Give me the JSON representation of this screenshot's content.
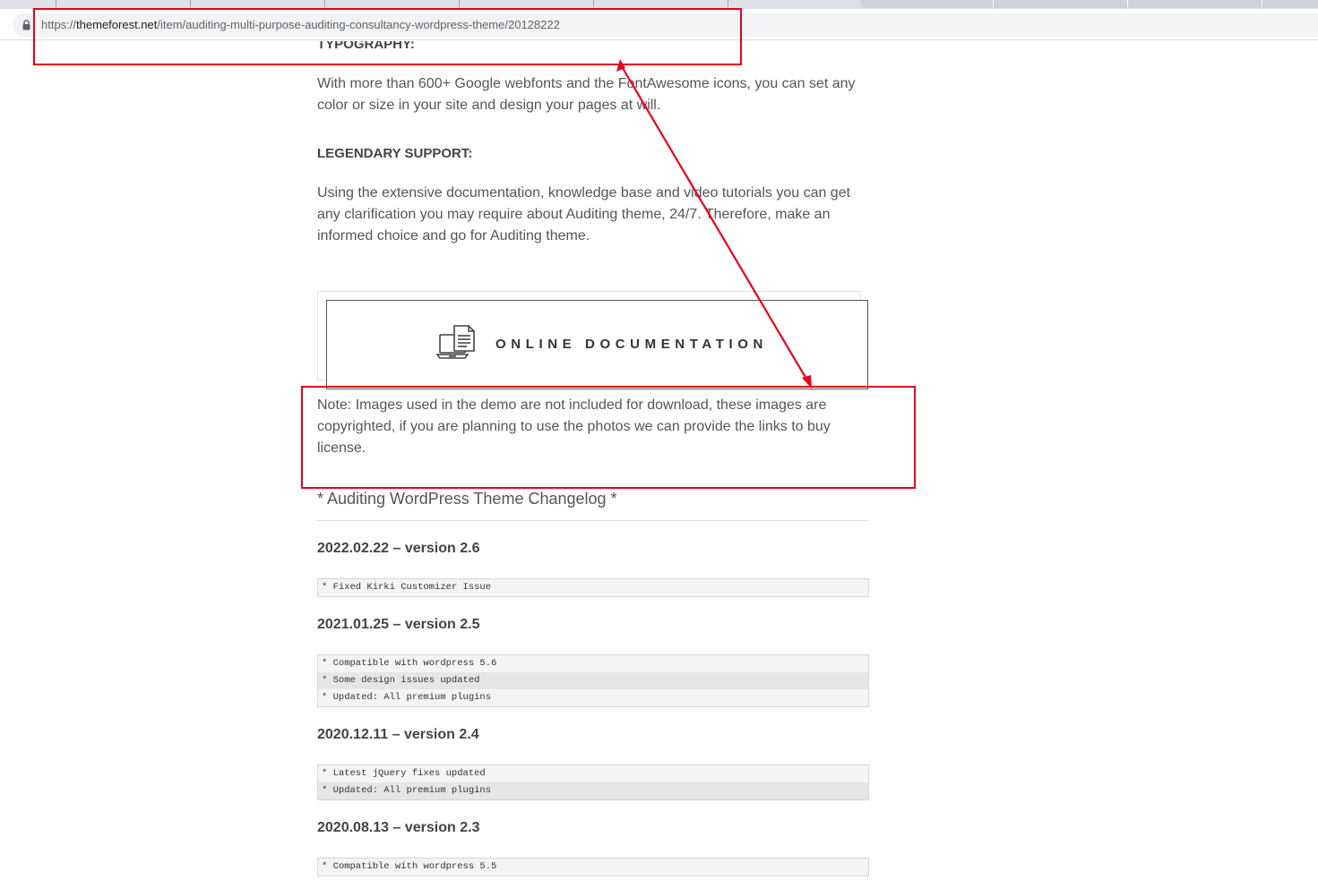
{
  "browser": {
    "url_prefix": "https://",
    "url_domain": "themeforest.net",
    "url_path": "/item/auditing-multi-purpose-auditing-consultancy-wordpress-theme/20128222"
  },
  "content": {
    "typography_heading": "TYPOGRAPHY:",
    "typography_text": "With more than 600+ Google webfonts and the FontAwesome icons, you can set any color or size in your site and design your pages at will.",
    "support_heading": "LEGENDARY SUPPORT:",
    "support_text": "Using the extensive documentation, knowledge base and video tutorials you can get any clarification you may require about Auditing theme, 24/7. Therefore, make an informed choice and go for Auditing theme.",
    "doc_button_label": "ONLINE DOCUMENTATION",
    "note_text": "Note: Images used in the demo are not included for download, these images are copyrighted, if you are planning to use the photos we can provide the links to buy license.",
    "changelog_title": "* Auditing WordPress Theme Changelog *"
  },
  "changelog": [
    {
      "version": "2022.02.22 – version 2.6",
      "lines": [
        "* Fixed Kirki Customizer Issue"
      ]
    },
    {
      "version": "2021.01.25 – version 2.5",
      "lines": [
        "* Compatible with wordpress 5.6",
        "* Some design issues updated",
        "* Updated: All premium plugins"
      ]
    },
    {
      "version": "2020.12.11 – version 2.4",
      "lines": [
        "* Latest jQuery fixes updated",
        "* Updated: All premium plugins"
      ]
    },
    {
      "version": "2020.08.13 – version 2.3",
      "lines": [
        "* Compatible with wordpress 5.5"
      ]
    }
  ],
  "icons": {
    "lock": "lock-icon",
    "documentation": "laptop-document-icon"
  },
  "colors": {
    "annotation": "#e8001c",
    "text": "#555555",
    "heading": "#444444"
  }
}
